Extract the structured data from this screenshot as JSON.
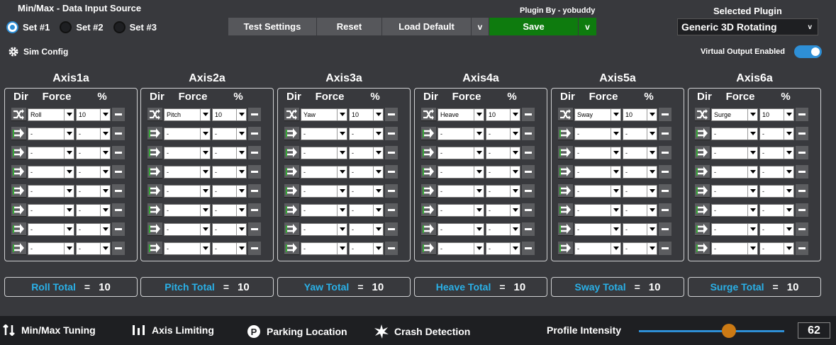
{
  "header": {
    "source_title": "Min/Max - Data Input Source",
    "sets": [
      {
        "label": "Set #1",
        "selected": true
      },
      {
        "label": "Set #2",
        "selected": false
      },
      {
        "label": "Set #3",
        "selected": false
      }
    ],
    "plugin_by": "Plugin By - yobuddy",
    "test_settings": "Test Settings",
    "reset": "Reset",
    "load_default": "Load Default",
    "v": "v",
    "save": "Save",
    "selected_plugin_label": "Selected Plugin",
    "selected_plugin": "Generic 3D Rotating",
    "sim_config": "Sim Config",
    "virtual_output": "Virtual Output Enabled"
  },
  "colors": {
    "accent": "#2e8fd6",
    "save": "#0e7b0e",
    "total_label": "#2ab1e8",
    "knob": "#cc7a14"
  },
  "columns": {
    "dir": "Dir",
    "force": "Force",
    "pct": "%"
  },
  "axes": [
    {
      "name": "Axis1a",
      "force": "Roll",
      "pct": "10",
      "total_label": "Roll Total",
      "eq": "=",
      "total": "10"
    },
    {
      "name": "Axis2a",
      "force": "Pitch",
      "pct": "10",
      "total_label": "Pitch Total",
      "eq": "=",
      "total": "10"
    },
    {
      "name": "Axis3a",
      "force": "Yaw",
      "pct": "10",
      "total_label": "Yaw Total",
      "eq": "=",
      "total": "10"
    },
    {
      "name": "Axis4a",
      "force": "Heave",
      "pct": "10",
      "total_label": "Heave Total",
      "eq": "=",
      "total": "10"
    },
    {
      "name": "Axis5a",
      "force": "Sway",
      "pct": "10",
      "total_label": "Sway Total",
      "eq": "=",
      "total": "10"
    },
    {
      "name": "Axis6a",
      "force": "Surge",
      "pct": "10",
      "total_label": "Surge Total",
      "eq": "=",
      "total": "10"
    }
  ],
  "empty_value": "-",
  "bottom": {
    "minmax": "Min/Max Tuning",
    "axis_limiting": "Axis Limiting",
    "parking": "Parking Location",
    "crash": "Crash Detection",
    "profile_intensity": "Profile Intensity",
    "intensity_value": "62",
    "intensity_fraction": 0.62
  }
}
